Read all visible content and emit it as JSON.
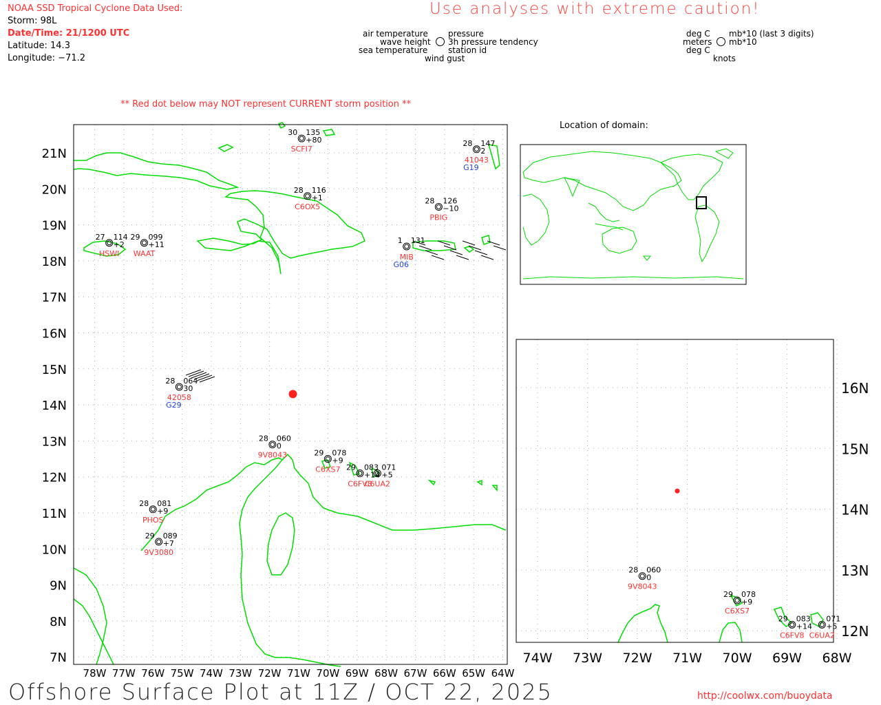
{
  "header": {
    "source_title": "NOAA SSD Tropical Cyclone Data Used:",
    "storm": "Storm: 98L",
    "datetime": "Date/Time: 21/1200 UTC",
    "latitude": "Latitude: 14.3",
    "longitude": "Longitude: −71.2",
    "caution": "Use analyses with extreme caution!",
    "red_dot_note": "** Red dot below may NOT represent CURRENT storm position **"
  },
  "legend": {
    "left": {
      "air_temperature": "air temperature",
      "pressure": "pressure",
      "wave_height": "wave height",
      "pressure_tendency": "3h pressure tendency",
      "sea_temperature": "sea temperature",
      "station_id": "station id",
      "wind_gust": "wind gust"
    },
    "right": {
      "deg_c_1": "deg C",
      "mb": "mb*10 (last 3 digits)",
      "meters": "meters",
      "mb2": "mb*10",
      "deg_c_2": "deg C",
      "knots": "knots"
    }
  },
  "main_map": {
    "lat_labels": [
      "21N",
      "20N",
      "19N",
      "18N",
      "17N",
      "16N",
      "15N",
      "14N",
      "13N",
      "12N",
      "11N",
      "10N",
      "9N",
      "8N",
      "7N"
    ],
    "lon_labels": [
      "78W",
      "77W",
      "76W",
      "75W",
      "74W",
      "73W",
      "72W",
      "71W",
      "70W",
      "69W",
      "68W",
      "67W",
      "66W",
      "65W",
      "64W"
    ],
    "storm_marker": {
      "lat": 14.3,
      "lon": -71.2,
      "color": "#ff2020"
    },
    "stations": [
      {
        "lat": 21.4,
        "lon": -70.9,
        "temp": "30",
        "press": "135",
        "tend": "+80",
        "id": "SCFI7",
        "id_color": "#ff3030",
        "gust": ""
      },
      {
        "lat": 21.1,
        "lon": -64.9,
        "temp": "28",
        "press": "147",
        "tend": "2",
        "id": "41043",
        "id_color": "#ff3030",
        "gust": "G19"
      },
      {
        "lat": 19.8,
        "lon": -70.7,
        "temp": "28",
        "press": "116",
        "tend": "+1",
        "id": "C6OX5",
        "id_color": "#ff3030",
        "gust": ""
      },
      {
        "lat": 19.5,
        "lon": -66.2,
        "temp": "28",
        "press": "126",
        "tend": "−10",
        "id": "PBIG",
        "id_color": "#ff3030",
        "gust": ""
      },
      {
        "lat": 18.5,
        "lon": -77.5,
        "temp": "27",
        "press": "114",
        "tend": "+2",
        "id": "HSWI",
        "id_color": "#ff3030",
        "gust": ""
      },
      {
        "lat": 18.5,
        "lon": -76.3,
        "temp": "29",
        "press": "099",
        "tend": "+11",
        "id": "WAAT",
        "id_color": "#ff3030",
        "gust": ""
      },
      {
        "lat": 18.4,
        "lon": -67.3,
        "temp": "1",
        "press": "131",
        "tend": "",
        "id": "MIB",
        "id_color": "#ff3030",
        "gust": "G06"
      },
      {
        "lat": 14.5,
        "lon": -75.1,
        "temp": "28",
        "press": "064",
        "tend": "30",
        "id": "42058",
        "id_color": "#ff3030",
        "gust": "G29"
      },
      {
        "lat": 12.9,
        "lon": -71.9,
        "temp": "28",
        "press": "060",
        "tend": "0",
        "id": "9V8043",
        "id_color": "#ff3030",
        "gust": ""
      },
      {
        "lat": 12.5,
        "lon": -70.0,
        "temp": "29",
        "press": "078",
        "tend": "+9",
        "id": "C6XS7",
        "id_color": "#ff3030",
        "gust": ""
      },
      {
        "lat": 12.1,
        "lon": -68.9,
        "temp": "29",
        "press": "083",
        "tend": "+14",
        "id": "C6FV8",
        "id_color": "#ff3030",
        "gust": ""
      },
      {
        "lat": 12.1,
        "lon": -68.3,
        "temp": "",
        "press": "071",
        "tend": "+5",
        "id": "C6UA2",
        "id_color": "#ff3030",
        "gust": ""
      },
      {
        "lat": 11.1,
        "lon": -76.0,
        "temp": "28",
        "press": "081",
        "tend": "+9",
        "id": "PHOS",
        "id_color": "#ff3030",
        "gust": ""
      },
      {
        "lat": 10.2,
        "lon": -75.8,
        "temp": "29",
        "press": "089",
        "tend": "+7",
        "id": "9V3080",
        "id_color": "#ff3030",
        "gust": ""
      }
    ]
  },
  "location_map": {
    "title": "Location of domain:"
  },
  "zoom_map": {
    "lat_labels": [
      "16N",
      "15N",
      "14N",
      "13N",
      "12N"
    ],
    "lon_labels": [
      "74W",
      "73W",
      "72W",
      "71W",
      "70W",
      "69W",
      "68W"
    ],
    "storm_marker": {
      "lat": 14.3,
      "lon": -71.2,
      "color": "#ff2020"
    },
    "stations": [
      {
        "lat": 12.9,
        "lon": -71.9,
        "temp": "28",
        "press": "060",
        "tend": "0",
        "id": "9V8043"
      },
      {
        "lat": 12.5,
        "lon": -70.0,
        "temp": "29",
        "press": "078",
        "tend": "+9",
        "id": "C6XS7"
      },
      {
        "lat": 12.1,
        "lon": -68.9,
        "temp": "29",
        "press": "083",
        "tend": "+14",
        "id": "C6FV8"
      },
      {
        "lat": 12.1,
        "lon": -68.3,
        "temp": "",
        "press": "071",
        "tend": "+5",
        "id": "C6UA2"
      }
    ]
  },
  "footer": {
    "title": "Offshore Surface Plot at 11Z / OCT 22, 2025",
    "url": "http://coolwx.com/buoydata"
  },
  "colors": {
    "land": "#00dd00",
    "grid": "#aaaaaa",
    "accent_red": "#ff3030",
    "gust_blue": "#2040e0"
  }
}
